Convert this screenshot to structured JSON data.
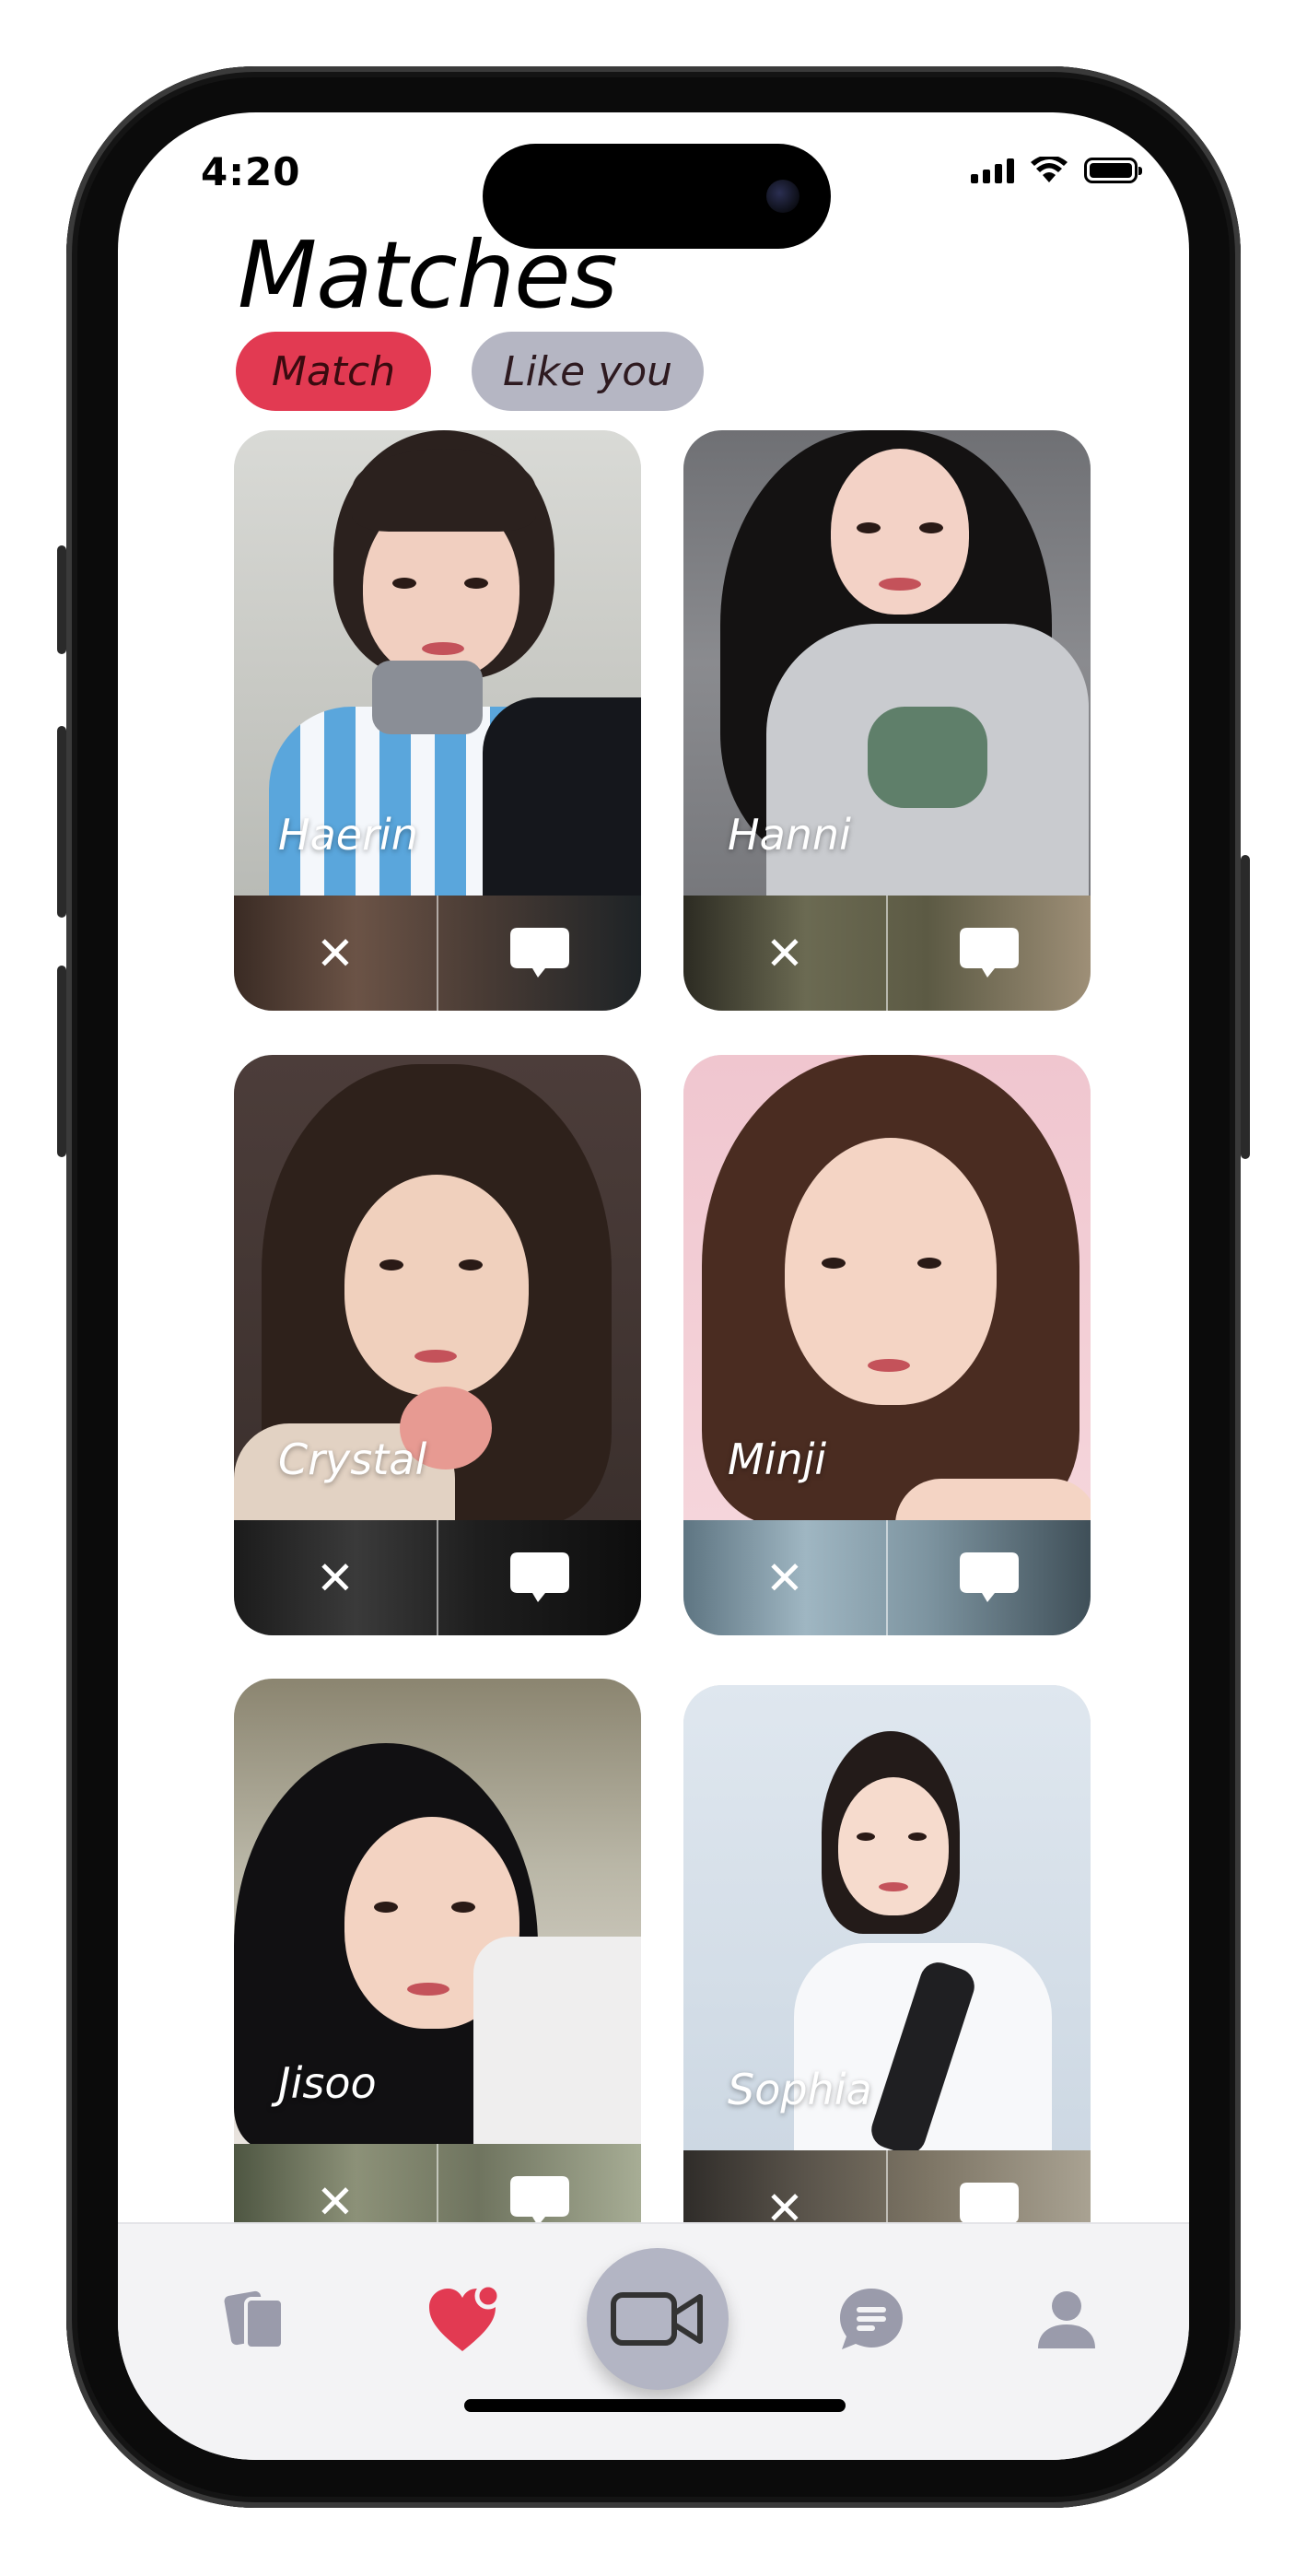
{
  "status_bar": {
    "time": "4:20"
  },
  "header": {
    "title": "Matches"
  },
  "tabs": [
    {
      "label": "Match",
      "active": true
    },
    {
      "label": "Like you",
      "active": false
    }
  ],
  "matches": [
    {
      "name": "Haerin"
    },
    {
      "name": "Hanni"
    },
    {
      "name": "Crystal"
    },
    {
      "name": "Minji"
    },
    {
      "name": "Jisoo"
    },
    {
      "name": "Sophia"
    }
  ],
  "card_actions": {
    "dismiss_icon": "close-icon",
    "message_icon": "chat-bubble-icon"
  },
  "bottom_nav": {
    "items": [
      {
        "icon": "cards-icon",
        "active": false
      },
      {
        "icon": "heart-notification-icon",
        "active": true
      },
      {
        "icon": "video-camera-icon",
        "active": false
      },
      {
        "icon": "message-icon",
        "active": false
      },
      {
        "icon": "profile-icon",
        "active": false
      }
    ]
  },
  "colors": {
    "accent": "#e23a52",
    "tab_inactive": "#b5b6c3",
    "nav_background": "#f3f3f5",
    "nav_icon": "#9a9bab",
    "fab": "#b3b5c4"
  }
}
